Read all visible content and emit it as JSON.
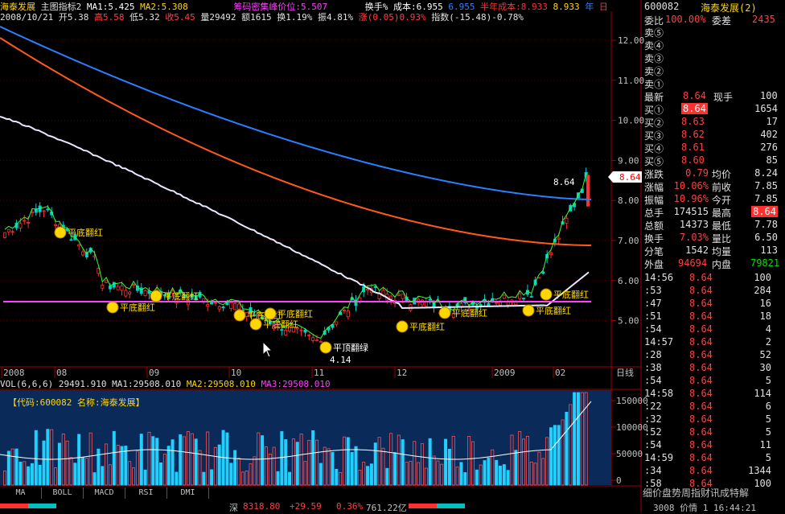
{
  "header": {
    "stock_name": "海泰发展",
    "indicator_name": "主图指标2",
    "ma1": "MA1:5.425",
    "ma2": "MA2:5.308",
    "chip_peak": "筹码密集峰价位:5.507",
    "turnover_cost": "换手% 成本:6.955",
    "cost_val": "6.955",
    "half_year_cost": "半年成本:8.933",
    "half_year_val": "8.933",
    "year_label": "年",
    "day_label": "日",
    "date": "2008/10/21",
    "open": "开5.38",
    "high": "高5.58",
    "low": "低5.32",
    "close": "收5.45",
    "volume": "量29492",
    "amount": "额1615",
    "turnover": "换1.19%",
    "amplitude": "振4.81%",
    "change": "涨(0.05)0.93%",
    "index": "指数(-15.48)-0.78%"
  },
  "price_axis": [
    "12.00",
    "11.00",
    "10.00",
    "9.00",
    "8.00",
    "7.00",
    "6.00",
    "5.00"
  ],
  "time_axis": [
    "2008",
    "08",
    "09",
    "10",
    "11",
    "12",
    "2009",
    "02"
  ],
  "time_axis_label": "日线",
  "last_price_tag": "8.64",
  "last_price_label": "8.64",
  "low_label": "4.14",
  "signals": [
    {
      "label": "平底翻红"
    },
    {
      "label": "平底翻红"
    },
    {
      "label": "平底翻红"
    },
    {
      "label": "平底翻红"
    },
    {
      "label": "平底翻红"
    },
    {
      "label": "平底翻红"
    },
    {
      "label": "平顶翻绿"
    },
    {
      "label": "平底翻红"
    },
    {
      "label": "平底翻红"
    },
    {
      "label": "平底翻红"
    },
    {
      "label": "平底翻红"
    }
  ],
  "volume_bar": {
    "label": "VOL(6,6,6)",
    "value": "29491.910",
    "ma1": "MA1:29508.010",
    "ma2": "MA2:29508.010",
    "ma3": "MA3:29508.010"
  },
  "volume_panel_title": "【代码:600082 名称:海泰发展】",
  "volume_axis": [
    "150000",
    "100000",
    "50000",
    "0"
  ],
  "tabs": [
    "MA",
    "BOLL",
    "MACD",
    "RSI",
    "DMI"
  ],
  "bottom": {
    "index_name": "深",
    "index_value": "8318.80",
    "index_change": "+29.59",
    "index_pct": "0.36%",
    "index_amount": "761.22亿",
    "right_text": "3008 价情 1 16:44:21"
  },
  "right_panel": {
    "code": "600082",
    "name": "海泰发展(2)",
    "weibi_label": "委比",
    "weibi_value": "100.00%",
    "weicha_label": "委差",
    "weicha_value": "2435",
    "sell_levels": [
      "卖⑤",
      "卖④",
      "卖③",
      "卖②",
      "卖①"
    ],
    "latest_label": "最新",
    "latest_value": "8.64",
    "xianshou_label": "现手",
    "xianshou_value": "100",
    "buy_levels": [
      {
        "label": "买①",
        "price": "8.64",
        "vol": "1654"
      },
      {
        "label": "买②",
        "price": "8.63",
        "vol": "17"
      },
      {
        "label": "买③",
        "price": "8.62",
        "vol": "402"
      },
      {
        "label": "买④",
        "price": "8.61",
        "vol": "276"
      },
      {
        "label": "买⑤",
        "price": "8.60",
        "vol": "85"
      }
    ],
    "stats": [
      {
        "l1": "涨跌",
        "v1": "0.79",
        "l2": "均价",
        "v2": "8.24"
      },
      {
        "l1": "涨幅",
        "v1": "10.06%",
        "l2": "前收",
        "v2": "7.85"
      },
      {
        "l1": "振幅",
        "v1": "10.96%",
        "l2": "今开",
        "v2": "7.85"
      },
      {
        "l1": "总手",
        "v1": "174515",
        "l2": "最高",
        "v2": "8.64"
      },
      {
        "l1": "总额",
        "v1": "14373",
        "l2": "最低",
        "v2": "7.78"
      },
      {
        "l1": "换手",
        "v1": "7.03%",
        "l2": "量比",
        "v2": "6.50"
      },
      {
        "l1": "分笔",
        "v1": "1542",
        "l2": "均量",
        "v2": "113"
      }
    ],
    "waipan_label": "外盘",
    "waipan_value": "94694",
    "neipan_label": "内盘",
    "neipan_value": "79821",
    "ticks": [
      {
        "t": "14:56",
        "p": "8.64",
        "v": "100"
      },
      {
        "t": ":53",
        "p": "8.64",
        "v": "284"
      },
      {
        "t": ":47",
        "p": "8.64",
        "v": "16"
      },
      {
        "t": ":51",
        "p": "8.64",
        "v": "18"
      },
      {
        "t": ":54",
        "p": "8.64",
        "v": "4"
      },
      {
        "t": "14:57",
        "p": "8.64",
        "v": "2"
      },
      {
        "t": ":28",
        "p": "8.64",
        "v": "52"
      },
      {
        "t": ":38",
        "p": "8.64",
        "v": "30"
      },
      {
        "t": ":54",
        "p": "8.64",
        "v": "5"
      },
      {
        "t": "14:58",
        "p": "8.64",
        "v": "114"
      },
      {
        "t": ":22",
        "p": "8.64",
        "v": "6"
      },
      {
        "t": ":32",
        "p": "8.64",
        "v": "5"
      },
      {
        "t": ":52",
        "p": "8.64",
        "v": "5"
      },
      {
        "t": ":54",
        "p": "8.64",
        "v": "11"
      },
      {
        "t": "14:59",
        "p": "8.64",
        "v": "5"
      },
      {
        "t": ":34",
        "p": "8.64",
        "v": "1344"
      },
      {
        "t": ":58",
        "p": "8.64",
        "v": "100"
      }
    ],
    "bottom_tabs": "细价盘势周指财讯成特解"
  }
}
